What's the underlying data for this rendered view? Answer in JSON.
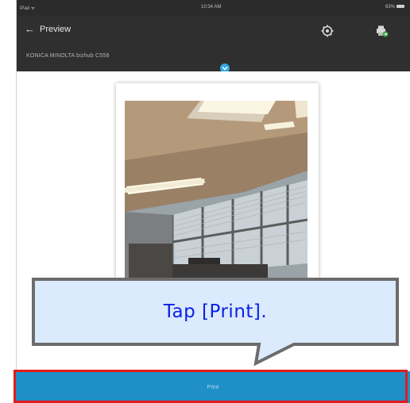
{
  "status_bar": {
    "carrier": "iPad ᯤ",
    "time": "10:34 AM",
    "battery": "63%"
  },
  "toolbar": {
    "back_label": "Preview",
    "printer_name": "KONICA MINOLTA bizhub C558",
    "icons": [
      "settings-gear-icon",
      "printer-swap-icon",
      "chevron-down-icon",
      "back-arrow-icon"
    ]
  },
  "preview": {
    "image": "photo of office ceiling with fluorescent lights and windows"
  },
  "print_button": {
    "label": "Print"
  },
  "callout": {
    "text": "Tap [Print]."
  },
  "colors": {
    "toolbar_bg": "#2f2f2f",
    "print_bar": "#1e8fc7",
    "highlight": "#e21b1b",
    "callout_fill": "#dbeafc",
    "callout_text": "#0b20e6"
  }
}
